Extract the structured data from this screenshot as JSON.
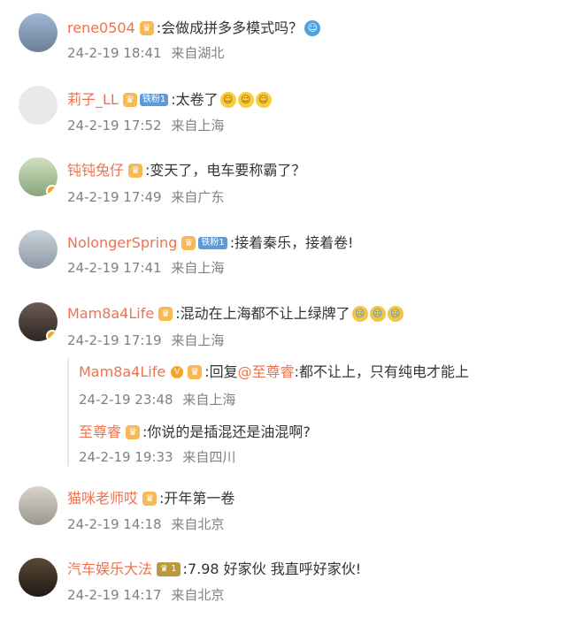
{
  "comments": [
    {
      "user": "rene0504",
      "text": ":会做成拼多多模式吗？",
      "time": "24-2-19 18:41",
      "location": "来自湖北",
      "emojis": [
        "emoji-icon"
      ]
    },
    {
      "user": "莉子_LL",
      "tag": "铁粉1",
      "text": ":太卷了",
      "time": "24-2-19 17:52",
      "location": "来自上海",
      "emojis": [
        "emoji-icon",
        "emoji-icon",
        "emoji-icon"
      ]
    },
    {
      "user": "钝钝兔仔",
      "text": ":变天了，电车要称霸了？",
      "time": "24-2-19 17:49",
      "location": "来自广东",
      "verified": true
    },
    {
      "user": "NolongerSpring",
      "tag": "铁粉1",
      "text": ":接着秦乐，接着卷!",
      "time": "24-2-19 17:41",
      "location": "来自上海"
    },
    {
      "user": "Mam8a4Life",
      "text": ":混动在上海都不让上绿牌了",
      "time": "24-2-19 17:19",
      "location": "来自上海",
      "verified": true,
      "emojis": [
        "cry-icon",
        "cry-icon",
        "cry-icon"
      ]
    },
    {
      "user": "猫咪老师哎",
      "text": ":开年第一卷",
      "time": "24-2-19 14:18",
      "location": "来自北京"
    },
    {
      "user": "汽车娱乐大法",
      "vip": "1",
      "text": ":7.98 好家伙 我直呼好家伙!",
      "time": "24-2-19 14:17",
      "location": "来自北京"
    }
  ],
  "replies": [
    {
      "user": "Mam8a4Life",
      "prefix": ":回复",
      "mention": "@至尊睿",
      "text": ":都不让上，只有纯电才能上",
      "time": "24-2-19 23:48",
      "location": "来自上海"
    },
    {
      "user": "至尊睿",
      "text": ":你说的是插混还是油混啊?",
      "time": "24-2-19 19:33",
      "location": "来自四川"
    }
  ],
  "colors": {
    "username": "#eb7350",
    "meta": "#808080",
    "text": "#333333",
    "crown": "#f7b955",
    "fan_tag": "#5a9bd8"
  }
}
